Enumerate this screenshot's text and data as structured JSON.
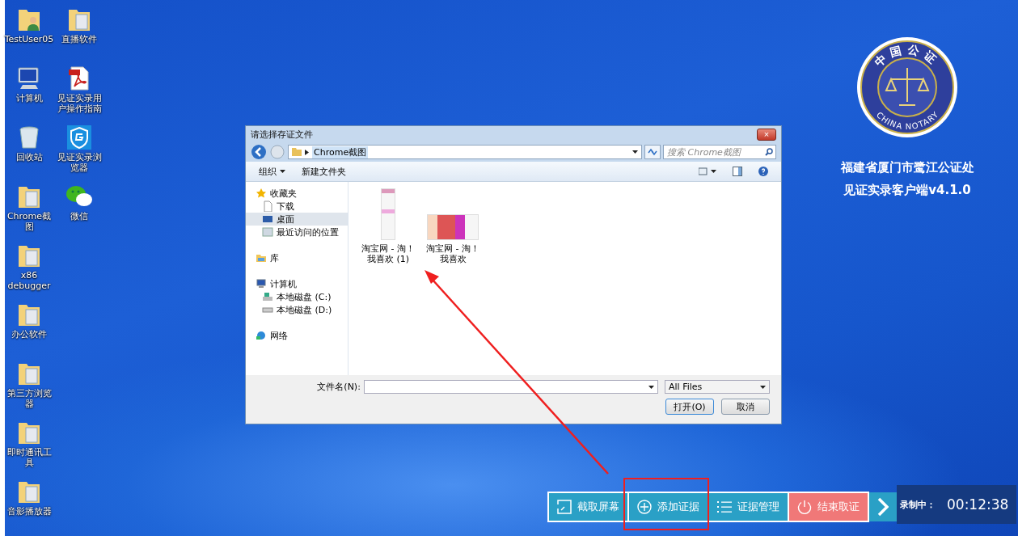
{
  "desktop": {
    "icons": [
      {
        "label": "TestUser05",
        "kind": "user-folder"
      },
      {
        "label": "直播软件",
        "kind": "folder"
      },
      {
        "label": "计算机",
        "kind": "computer"
      },
      {
        "label": "见证实录用户操作指南",
        "kind": "pdf"
      },
      {
        "label": "回收站",
        "kind": "recycle"
      },
      {
        "label": "见证实录浏览器",
        "kind": "app"
      },
      {
        "label": "Chrome截图",
        "kind": "folder"
      },
      {
        "label": "微信",
        "kind": "chat"
      },
      {
        "label": "x86 debugger",
        "kind": "folder"
      },
      {
        "label": "办公软件",
        "kind": "folder"
      },
      {
        "label": "第三方浏览器",
        "kind": "folder"
      },
      {
        "label": "即时通讯工具",
        "kind": "folder"
      },
      {
        "label": "音影播放器",
        "kind": "folder"
      }
    ]
  },
  "brand": {
    "seal_top": "中国公证",
    "seal_bottom": "CHINA NOTARY",
    "lines": [
      "福建省厦门市鹭江公证处",
      "见证实录客户端v4.1.0"
    ]
  },
  "dialog": {
    "title": "请选择存证文件",
    "close": "×",
    "address": {
      "path": "Chrome截图"
    },
    "search": {
      "placeholder": "搜索 Chrome截图"
    },
    "toolbar": {
      "organize": "组织",
      "new_folder": "新建文件夹"
    },
    "nav": [
      {
        "label": "收藏夹",
        "kind": "star",
        "selected": false,
        "children": [
          {
            "label": "下载",
            "kind": "page",
            "selected": false
          },
          {
            "label": "桌面",
            "kind": "desktop",
            "selected": true
          },
          {
            "label": "最近访问的位置",
            "kind": "recent",
            "selected": false
          }
        ]
      },
      {
        "label": "库",
        "kind": "library",
        "selected": false
      },
      {
        "label": "计算机",
        "kind": "computer",
        "selected": false,
        "children": [
          {
            "label": "本地磁盘 (C:)",
            "kind": "system-drive",
            "selected": false
          },
          {
            "label": "本地磁盘 (D:)",
            "kind": "drive",
            "selected": false
          }
        ]
      },
      {
        "label": "网络",
        "kind": "network",
        "selected": false
      }
    ],
    "files": [
      {
        "name": "淘宝网 - 淘！我喜欢 (1)",
        "kind": "tall"
      },
      {
        "name": "淘宝网 - 淘！我喜欢",
        "kind": "wide"
      }
    ],
    "filename": {
      "label": "文件名(N):"
    },
    "filter": "All Files",
    "buttons": [
      "打开(O)",
      "取消"
    ]
  },
  "toolbar": {
    "buttons": [
      {
        "label": "截取屏幕",
        "kind": "screenshot",
        "highlighted": false
      },
      {
        "label": "添加证据",
        "kind": "add",
        "highlighted": true
      },
      {
        "label": "证据管理",
        "kind": "manage",
        "highlighted": false
      },
      {
        "label": "结束取证",
        "kind": "stop",
        "highlighted": false
      }
    ],
    "recording": {
      "label": "录制中：",
      "time": "00:12:38"
    }
  }
}
